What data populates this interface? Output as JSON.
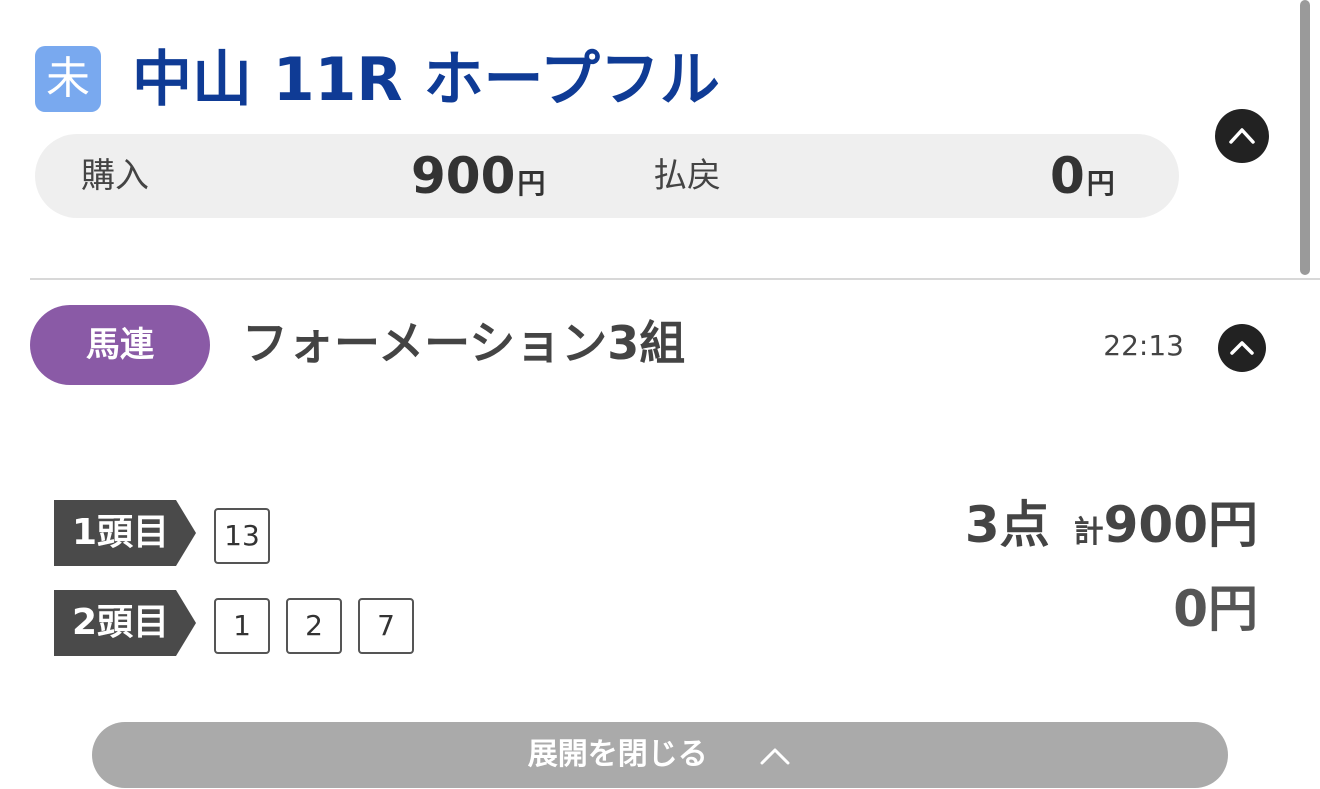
{
  "race": {
    "status_badge": "未",
    "title": "中山 11R ホープフル"
  },
  "summary": {
    "purchase_label": "購入",
    "purchase_value": "900",
    "payout_label": "払戻",
    "payout_value": "0",
    "yen": "円"
  },
  "bet": {
    "type": "馬連",
    "description": "フォーメーション3組",
    "time": "22:13",
    "positions": [
      {
        "label": "1頭目",
        "numbers": [
          "13"
        ]
      },
      {
        "label": "2頭目",
        "numbers": [
          "1",
          "2",
          "7"
        ]
      }
    ],
    "points": "3点",
    "total_prefix": "計",
    "total": "900円",
    "payout": "0円"
  },
  "collapse": {
    "label": "展開を閉じる"
  },
  "colors": {
    "title_blue": "#0f3b95",
    "badge_blue": "#79a9ef",
    "bet_type_purple": "#8a5aa6",
    "tag_dark": "#4a4a4a",
    "button_gray": "#aaaaaa"
  }
}
